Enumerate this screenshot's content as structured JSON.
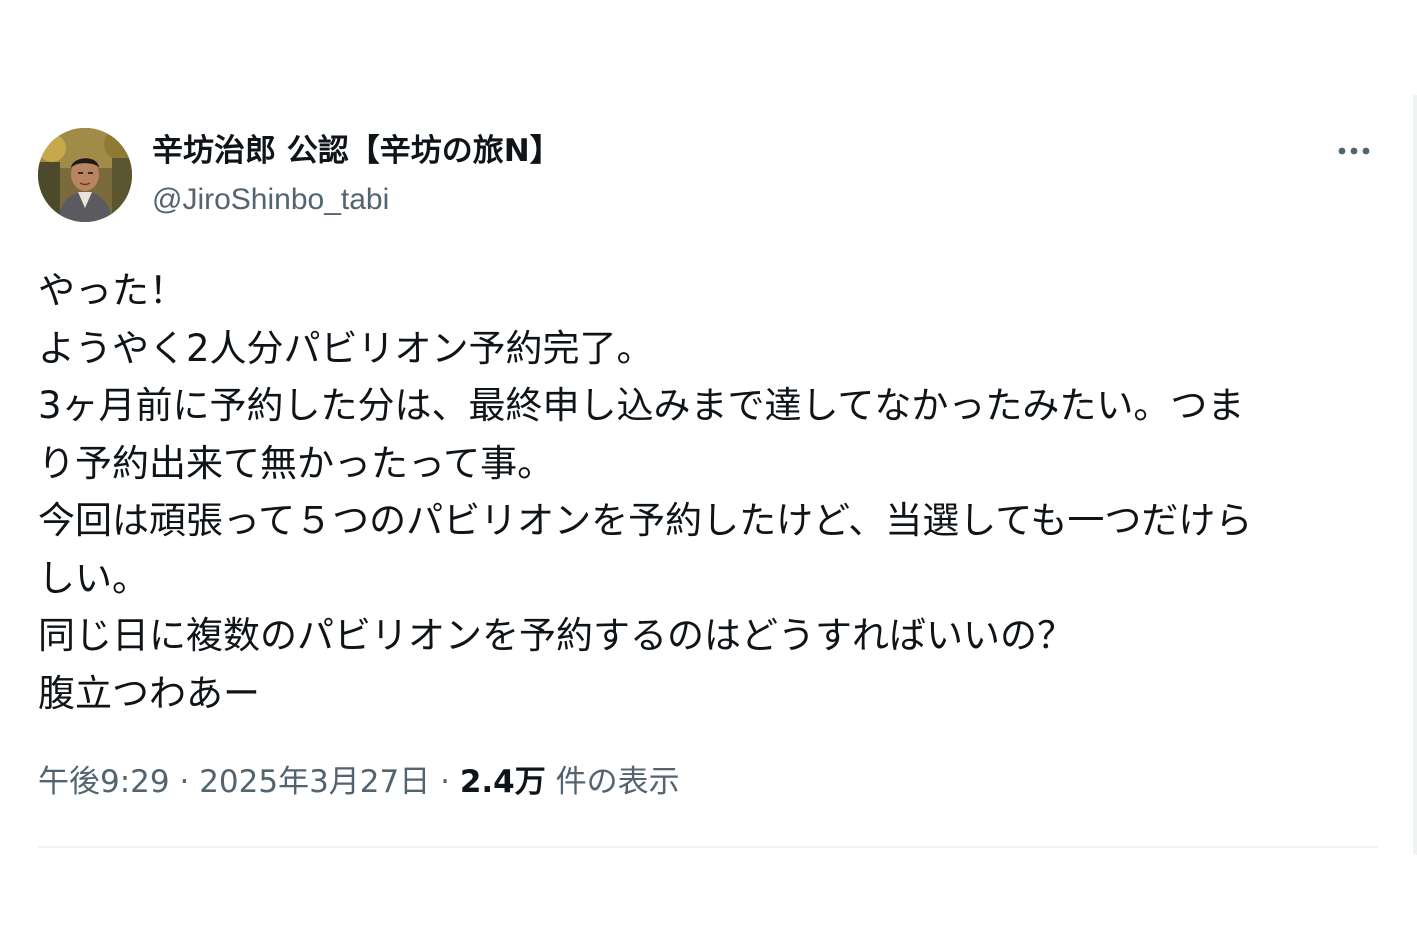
{
  "author": {
    "display_name": "辛坊治郎 公認【辛坊の旅N】",
    "handle": "@JiroShinbo_tabi",
    "avatar_icon": "avatar-photo"
  },
  "more_icon": "more-horizontal-icon",
  "body_lines": [
    "やった！",
    "ようやく2人分パビリオン予約完了。",
    "3ヶ月前に予約した分は、最終申し込みまで達してなかったみたい。つま",
    "り予約出来て無かったって事。",
    "今回は頑張って５つのパビリオンを予約したけど、当選しても一つだけら",
    "しい。",
    "同じ日に複数のパビリオンを予約するのはどうすればいいの？",
    "腹立つわあー"
  ],
  "meta": {
    "time": "午後9:29",
    "separator": " · ",
    "date": "2025年3月27日",
    "views_count": "2.4万",
    "views_label": " 件の表示"
  },
  "colors": {
    "text": "#0f1419",
    "secondary": "#536471",
    "divider": "#eff3f4"
  }
}
